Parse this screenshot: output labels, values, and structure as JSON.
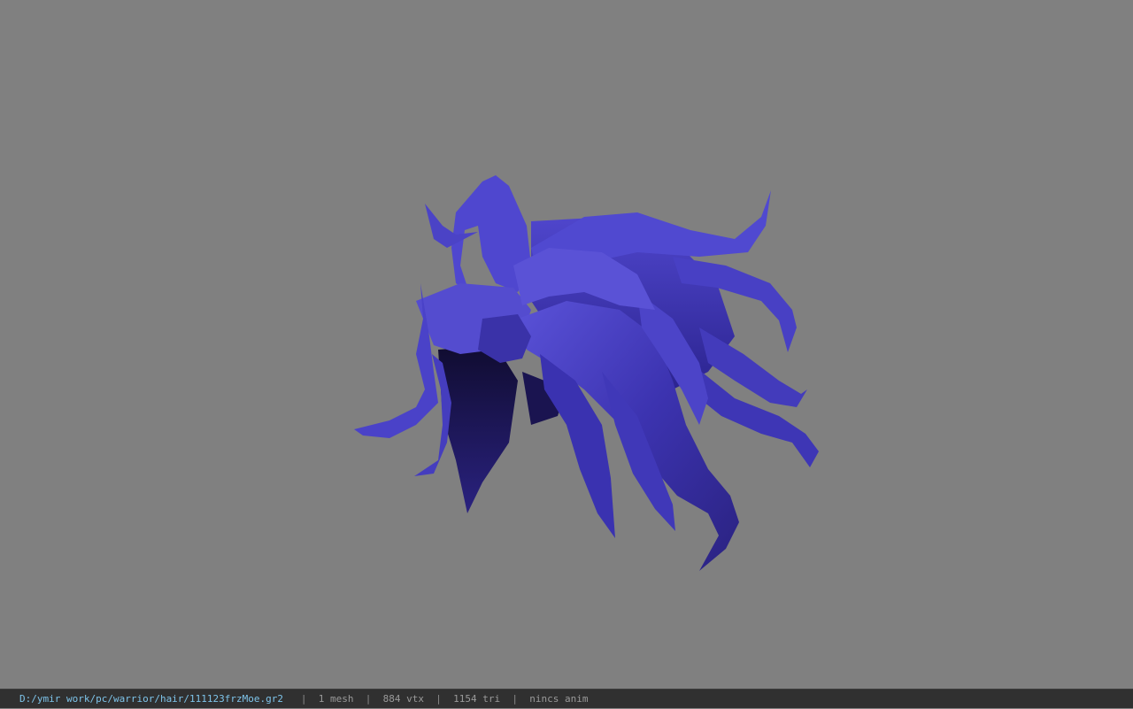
{
  "viewer": {
    "background_color": "#808080",
    "hair_color": "#4a3fc4",
    "model_icon": "hair-mesh-model"
  },
  "status": {
    "file_path": "D:/ymir work/pc/warrior/hair/111123frzMoe.gr2",
    "mesh_count": "1 mesh",
    "vertex_count": "884 vtx",
    "triangle_count": "1154 tri",
    "anim_status": "nincs anim",
    "separator": "|"
  }
}
